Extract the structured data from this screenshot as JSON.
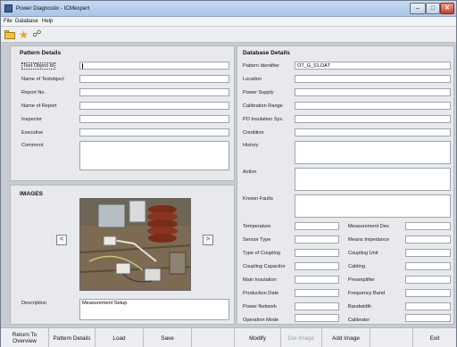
{
  "window": {
    "title": "Power Diagnostix - ICMexpert"
  },
  "menu": [
    "File",
    "Database",
    "Help"
  ],
  "toolbar": {
    "icons": [
      "folder-icon",
      "star-icon",
      "network-icon"
    ]
  },
  "pattern_details": {
    "title": "Pattern Details",
    "fields": [
      {
        "label": "Test Object Id",
        "value": ""
      },
      {
        "label": "Name of Testobject",
        "value": ""
      },
      {
        "label": "Report No.",
        "value": ""
      },
      {
        "label": "Name of Report",
        "value": ""
      },
      {
        "label": "Inspector",
        "value": ""
      },
      {
        "label": "Executive",
        "value": ""
      },
      {
        "label": "Comment",
        "value": ""
      }
    ]
  },
  "images": {
    "title": "IMAGES",
    "prev": "<",
    "next": ">",
    "description_label": "Description",
    "description_value": "Measurement Setup"
  },
  "database_details": {
    "title": "Database Details",
    "fields": [
      {
        "label": "Pattern Identifier",
        "value": "OT_G_01.DAT"
      },
      {
        "label": "Location",
        "value": ""
      },
      {
        "label": "Power Supply",
        "value": ""
      },
      {
        "label": "Calibration Range",
        "value": ""
      },
      {
        "label": "PD Insulation Sys.",
        "value": ""
      },
      {
        "label": "Condition",
        "value": ""
      },
      {
        "label": "History",
        "value": ""
      },
      {
        "label": "Action",
        "value": ""
      },
      {
        "label": "Known Faults",
        "value": ""
      }
    ],
    "left_pairs": [
      {
        "label": "Temperature",
        "value": ""
      },
      {
        "label": "Sensor Type",
        "value": ""
      },
      {
        "label": "Type of Coupling",
        "value": ""
      },
      {
        "label": "Coupling Capacitor",
        "value": ""
      },
      {
        "label": "Main Insulation",
        "value": ""
      },
      {
        "label": "Production Date",
        "value": ""
      },
      {
        "label": "Power Network",
        "value": ""
      },
      {
        "label": "Operation Mode",
        "value": ""
      }
    ],
    "right_pairs": [
      {
        "label": "Measurement Dev.",
        "value": ""
      },
      {
        "label": "Means Impedance",
        "value": ""
      },
      {
        "label": "Coupling Unit",
        "value": ""
      },
      {
        "label": "Cabling",
        "value": ""
      },
      {
        "label": "Preamplifier",
        "value": ""
      },
      {
        "label": "Frequency Band",
        "value": ""
      },
      {
        "label": "Bandwidth",
        "value": ""
      },
      {
        "label": "Calibrator",
        "value": ""
      }
    ]
  },
  "bottom_buttons": {
    "return": "Return To Overview",
    "pattern": "Pattern Details",
    "load": "Load",
    "save": "Save",
    "modify": "Modify",
    "del_image": "Del Image",
    "add_image": "Add Image",
    "exit": "Exit"
  }
}
